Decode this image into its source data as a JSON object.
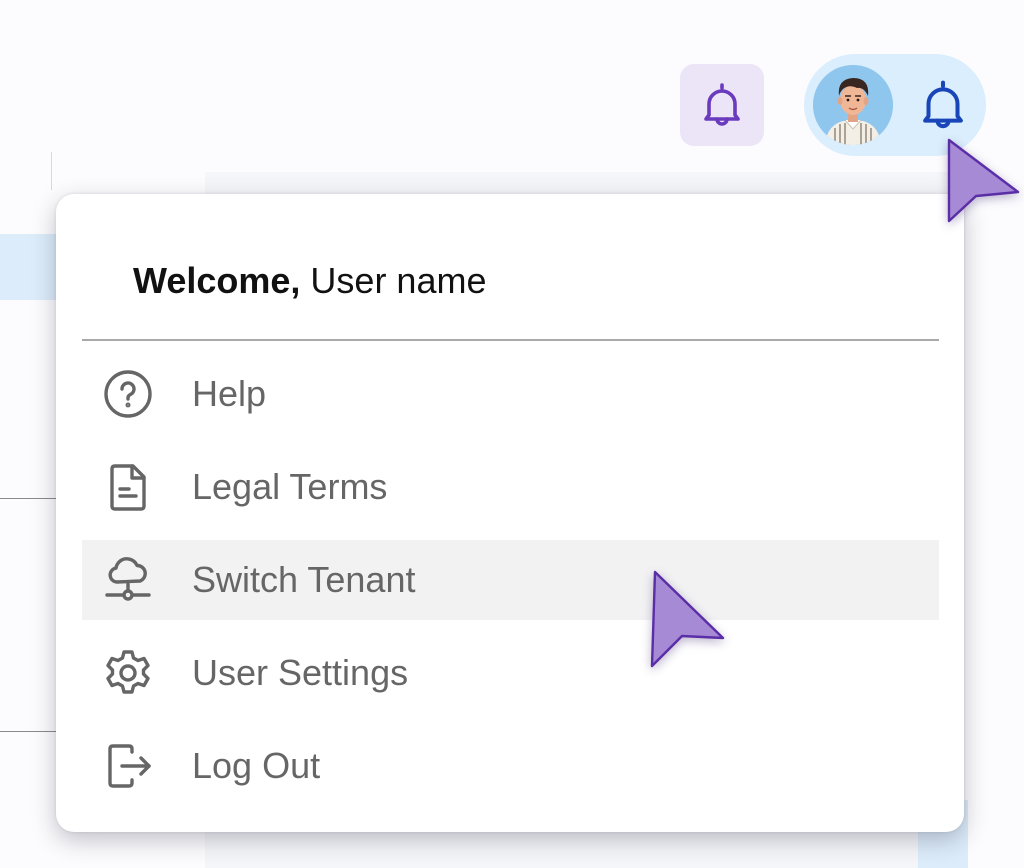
{
  "header": {
    "notifications_icon": "bell-icon",
    "account_icon": "bell-icon",
    "avatar_alt": "avatar"
  },
  "menu": {
    "welcome_bold": "Welcome,",
    "welcome_name": "User name",
    "items": [
      {
        "label": "Help",
        "icon": "help-circle-icon"
      },
      {
        "label": "Legal Terms",
        "icon": "document-icon"
      },
      {
        "label": "Switch Tenant",
        "icon": "cloud-network-icon"
      },
      {
        "label": "User Settings",
        "icon": "gear-icon"
      },
      {
        "label": "Log Out",
        "icon": "logout-icon"
      }
    ],
    "hovered_item": "Switch Tenant"
  },
  "colors": {
    "accent_purple": "#6a3bbd",
    "accent_blue": "#1846b8",
    "bell_button_bg": "#ece5f7",
    "account_pill_bg": "#dbeefd",
    "cursor_fill": "#a68ad6",
    "icon_gray": "#666666"
  }
}
